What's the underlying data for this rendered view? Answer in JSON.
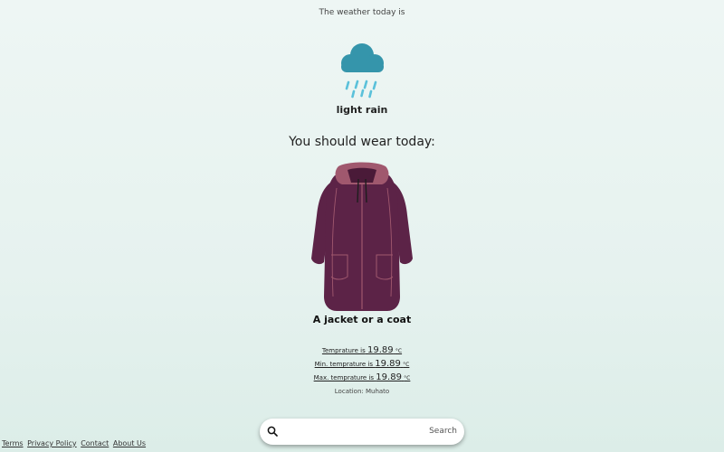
{
  "intro": "The weather today is",
  "weather": {
    "icon": "rain-cloud-icon",
    "condition": "light rain",
    "colors": {
      "cloud": "#3595ab",
      "rain": "#5bc1da"
    }
  },
  "advice": {
    "heading": "You should wear today:",
    "icon": "coat-icon",
    "garment": "A jacket or a coat",
    "colors": {
      "coat": "#5c2347",
      "lining": "#a0586e"
    }
  },
  "temperature": {
    "current": {
      "label": "Temprature is",
      "value": "19.89",
      "unit": "°C"
    },
    "min": {
      "label": "Min. temprature is",
      "value": "19.89",
      "unit": "°C"
    },
    "max": {
      "label": "Max. temprature is",
      "value": "19.89",
      "unit": "°C"
    }
  },
  "location": "Location: Muhato",
  "search": {
    "placeholder": "",
    "value": "",
    "button_label": "Search",
    "icon": "search-icon"
  },
  "footer": {
    "links": [
      "Terms",
      "Privacy Policy",
      "Contact",
      "About Us"
    ]
  }
}
